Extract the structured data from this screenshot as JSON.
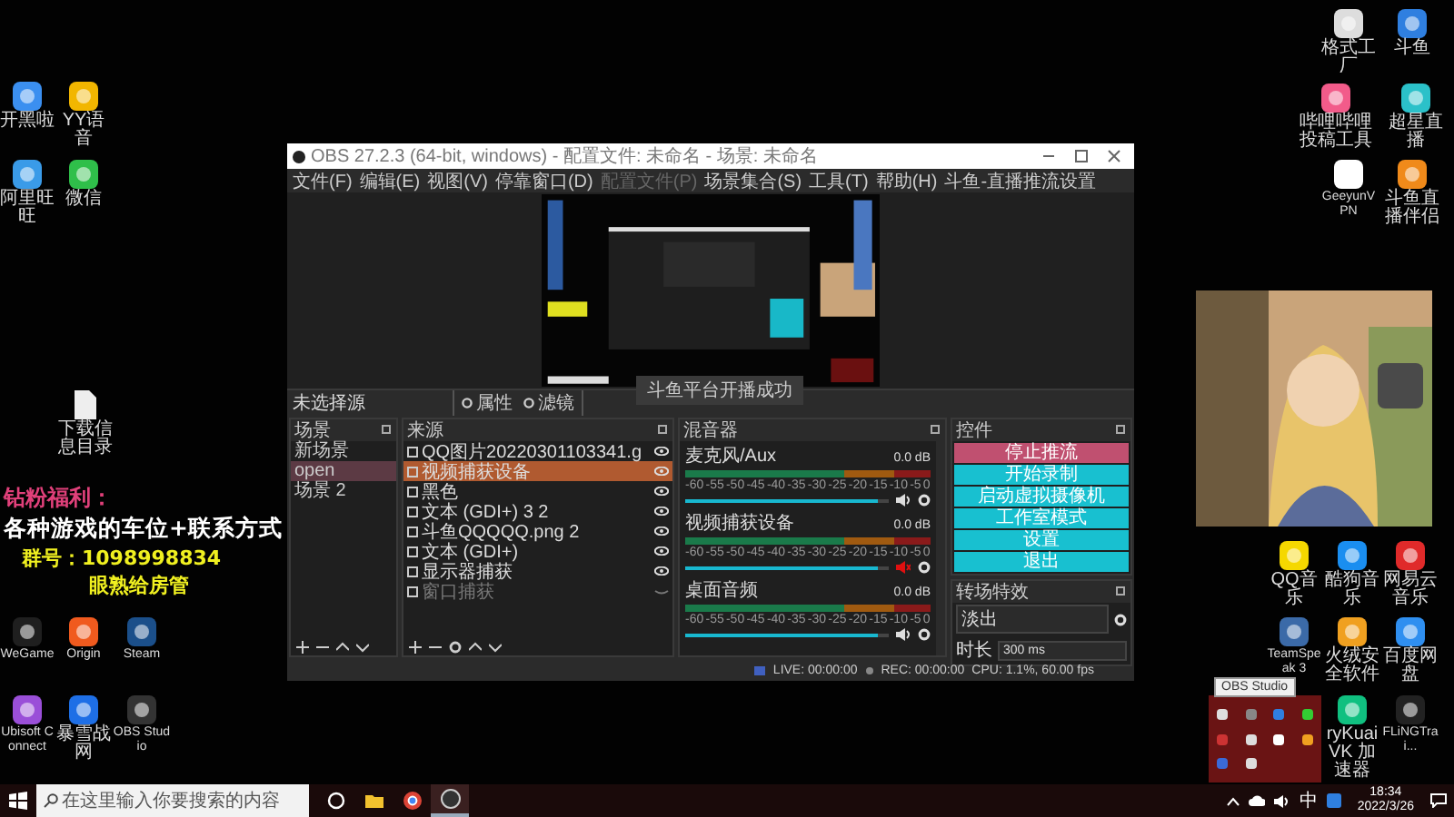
{
  "desktop_icons": [
    {
      "label": "开黑啦"
    },
    {
      "label": "YY语音"
    },
    {
      "label": "阿里旺旺"
    },
    {
      "label": "微信"
    },
    {
      "label": "下载信息目录"
    },
    {
      "label": "WeGame"
    },
    {
      "label": "Origin"
    },
    {
      "label": "Steam"
    },
    {
      "label": "Ubisoft Connect"
    },
    {
      "label": "暴雪战网"
    },
    {
      "label": "OBS Studio"
    },
    {
      "label": "格式工厂"
    },
    {
      "label": "斗鱼"
    },
    {
      "label": "哔哩哔哩投稿工具"
    },
    {
      "label": "超星直播"
    },
    {
      "label": "GeeyunVPN"
    },
    {
      "label": "斗鱼直播伴侣"
    },
    {
      "label": "QQ音乐"
    },
    {
      "label": "酷狗音乐"
    },
    {
      "label": "网易云音乐"
    },
    {
      "label": "TeamSpeak 3"
    },
    {
      "label": "火绒安全软件"
    },
    {
      "label": "百度网盘"
    },
    {
      "label": "ryKuai VK 加速器"
    },
    {
      "label": "FLiNGTrai..."
    }
  ],
  "overlay_text": {
    "title": "钻粉福利：",
    "line": "各种游戏的车位+联系方式",
    "group": "群号：1098998834",
    "note": "眼熟给房管"
  },
  "obs": {
    "title": "OBS 27.2.3 (64-bit, windows) - 配置文件: 未命名 - 场景: 未命名",
    "menu": [
      {
        "label": "文件(F)",
        "disabled": false
      },
      {
        "label": "编辑(E)",
        "disabled": false
      },
      {
        "label": "视图(V)",
        "disabled": false
      },
      {
        "label": "停靠窗口(D)",
        "disabled": false
      },
      {
        "label": "配置文件(P)",
        "disabled": true
      },
      {
        "label": "场景集合(S)",
        "disabled": false
      },
      {
        "label": "工具(T)",
        "disabled": false
      },
      {
        "label": "帮助(H)",
        "disabled": false
      },
      {
        "label": "斗鱼-直播推流设置",
        "disabled": false
      }
    ],
    "preview_toast": "斗鱼平台开播成功",
    "toolbar": {
      "no_source": "未选择源",
      "buttons": [
        "属性",
        "滤镜"
      ]
    },
    "scenes": {
      "title": "场景",
      "items": [
        {
          "label": "新场景",
          "selected": false
        },
        {
          "label": "open",
          "selected": true
        },
        {
          "label": "场景 2",
          "selected": false
        }
      ]
    },
    "sources": {
      "title": "来源",
      "items": [
        {
          "label": "QQ图片20220301103341.g",
          "selected": false,
          "visible": true
        },
        {
          "label": "视频捕获设备",
          "selected": true,
          "visible": true
        },
        {
          "label": "黑色",
          "selected": false,
          "visible": true
        },
        {
          "label": "文本 (GDI+) 3 2",
          "selected": false,
          "visible": true
        },
        {
          "label": "斗鱼QQQQQ.png 2",
          "selected": false,
          "visible": true
        },
        {
          "label": "文本 (GDI+)",
          "selected": false,
          "visible": true
        },
        {
          "label": "显示器捕获",
          "selected": false,
          "visible": true
        },
        {
          "label": "窗口捕获",
          "selected": false,
          "visible": false
        }
      ]
    },
    "mixer": {
      "title": "混音器",
      "channels": [
        {
          "name": "麦克风/Aux",
          "reading": "0.0 dB",
          "scale": [
            "-60",
            "-55",
            "-50",
            "-45",
            "-40",
            "-35",
            "-30",
            "-25",
            "-20",
            "-15",
            "-10",
            "-5",
            "0"
          ],
          "level": 0.95,
          "muted": false
        },
        {
          "name": "视频捕获设备",
          "reading": "0.0 dB",
          "scale": [
            "-60",
            "-55",
            "-50",
            "-45",
            "-40",
            "-35",
            "-30",
            "-25",
            "-20",
            "-15",
            "-10",
            "-5",
            "0"
          ],
          "level": 0.95,
          "muted": true
        },
        {
          "name": "桌面音频",
          "reading": "0.0 dB",
          "scale": [
            "-60",
            "-55",
            "-50",
            "-45",
            "-40",
            "-35",
            "-30",
            "-25",
            "-20",
            "-15",
            "-10",
            "-5",
            "0"
          ],
          "level": 0.95,
          "muted": false
        }
      ]
    },
    "controls": {
      "title": "控件",
      "buttons": [
        {
          "label": "停止推流",
          "active": true
        },
        {
          "label": "开始录制",
          "active": false
        },
        {
          "label": "启动虚拟摄像机",
          "active": false
        },
        {
          "label": "工作室模式",
          "active": false
        },
        {
          "label": "设置",
          "active": false
        },
        {
          "label": "退出",
          "active": false
        }
      ]
    },
    "transitions": {
      "title": "转场特效",
      "value": "淡出",
      "duration_label": "时长",
      "duration": "300 ms"
    },
    "status": {
      "live": "LIVE: 00:00:00",
      "rec": "REC: 00:00:00",
      "cpu": "CPU: 1.1%, 60.00 fps"
    }
  },
  "tray_popup": {
    "tooltip": "OBS Studio"
  },
  "taskbar": {
    "search_placeholder": "在这里输入你要搜索的内容",
    "apps": [
      {
        "selected": false
      },
      {
        "selected": false
      },
      {
        "selected": false
      },
      {
        "selected": true
      }
    ],
    "ime": "中",
    "time": "18:34",
    "date": "2022/3/26"
  }
}
